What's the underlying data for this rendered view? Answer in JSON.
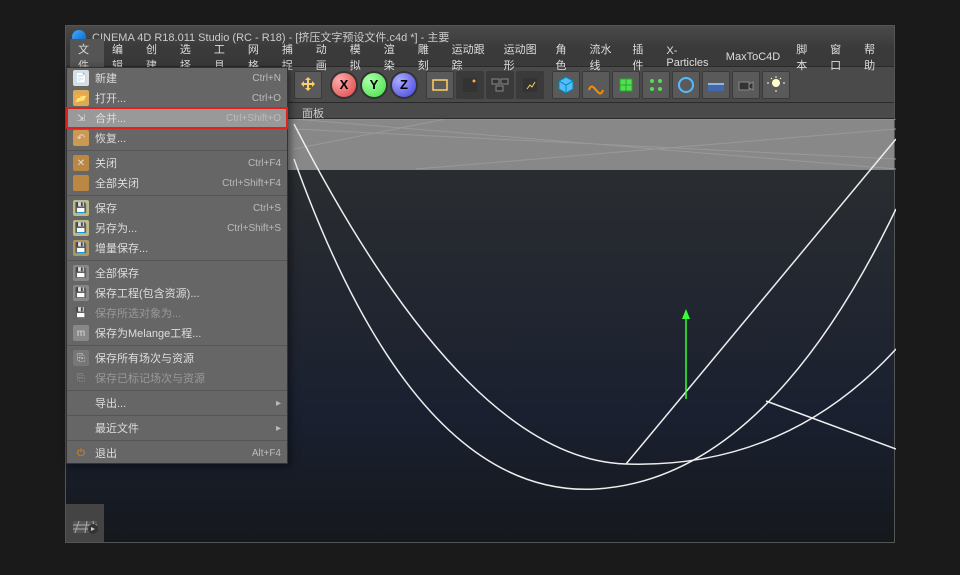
{
  "title": "CINEMA 4D R18.011 Studio (RC - R18) - [挤压文字预设文件.c4d *] - 主要",
  "menu": [
    "文件",
    "编辑",
    "创建",
    "选择",
    "工具",
    "网格",
    "捕捉",
    "动画",
    "模拟",
    "渲染",
    "雕刻",
    "运动跟踪",
    "运动图形",
    "角色",
    "流水线",
    "插件",
    "X-Particles",
    "MaxToC4D",
    "脚本",
    "窗口",
    "帮助"
  ],
  "panel_label": "面板",
  "axes": {
    "x": "X",
    "y": "Y",
    "z": "Z"
  },
  "file_menu": {
    "new": {
      "label": "新建",
      "shortcut": "Ctrl+N"
    },
    "open": {
      "label": "打开...",
      "shortcut": "Ctrl+O"
    },
    "merge": {
      "label": "合并...",
      "shortcut": "Ctrl+Shift+O"
    },
    "revert": {
      "label": "恢复...",
      "shortcut": ""
    },
    "close": {
      "label": "关闭",
      "shortcut": "Ctrl+F4"
    },
    "close_all": {
      "label": "全部关闭",
      "shortcut": "Ctrl+Shift+F4"
    },
    "save": {
      "label": "保存",
      "shortcut": "Ctrl+S"
    },
    "save_as": {
      "label": "另存为...",
      "shortcut": "Ctrl+Shift+S"
    },
    "save_inc": {
      "label": "增量保存...",
      "shortcut": ""
    },
    "save_all": {
      "label": "全部保存",
      "shortcut": ""
    },
    "save_proj": {
      "label": "保存工程(包含资源)...",
      "shortcut": ""
    },
    "save_sel": {
      "label": "保存所选对象为...",
      "shortcut": ""
    },
    "save_mel": {
      "label": "保存为Melange工程...",
      "shortcut": ""
    },
    "save_takes": {
      "label": "保存所有场次与资源",
      "shortcut": ""
    },
    "save_marked": {
      "label": "保存已标记场次与资源",
      "shortcut": ""
    },
    "export": {
      "label": "导出...",
      "shortcut": ""
    },
    "recent": {
      "label": "最近文件",
      "shortcut": ""
    },
    "quit": {
      "label": "退出",
      "shortcut": "Alt+F4"
    }
  }
}
